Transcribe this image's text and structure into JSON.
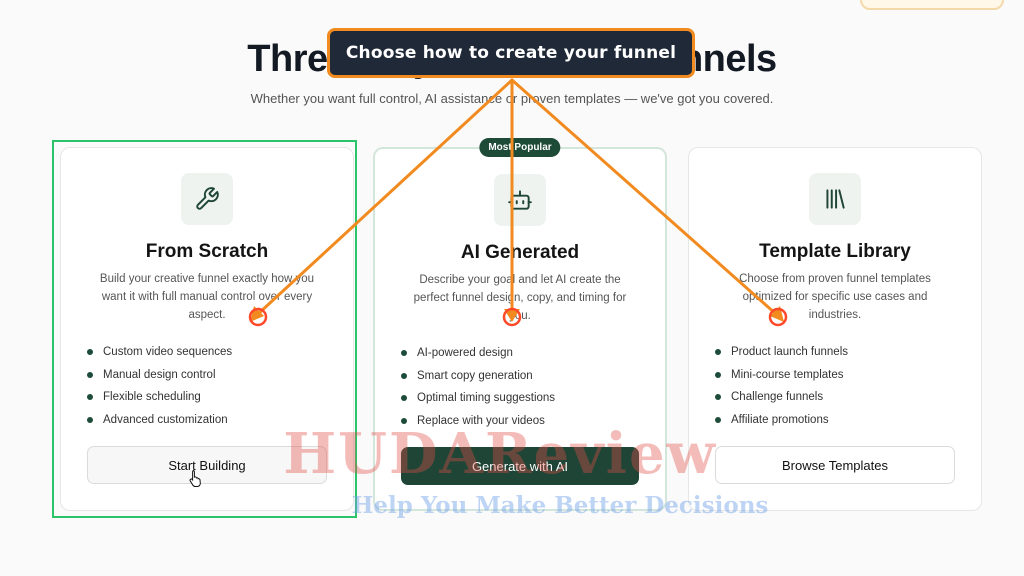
{
  "page": {
    "title": "Three Ways to Create Funnels",
    "subtitle": "Whether you want full control, AI assistance or proven templates — we've got you covered."
  },
  "callout": {
    "text": "Choose how to create your funnel"
  },
  "cards": [
    {
      "icon": "wrench-icon",
      "title": "From Scratch",
      "description": "Build your creative funnel exactly how you want it with full manual control over every aspect.",
      "features": [
        "Custom video sequences",
        "Manual design control",
        "Flexible scheduling",
        "Advanced customization"
      ],
      "button_label": "Start Building"
    },
    {
      "badge": "Most Popular",
      "icon": "robot-icon",
      "title": "AI Generated",
      "description": "Describe your goal and let AI create the perfect funnel design, copy, and timing for you.",
      "features": [
        "AI-powered design",
        "Smart copy generation",
        "Optimal timing suggestions",
        "Replace with your videos"
      ],
      "button_label": "Generate with AI"
    },
    {
      "icon": "library-icon",
      "title": "Template Library",
      "description": "Choose from proven funnel templates optimized for specific use cases and industries.",
      "features": [
        "Product launch funnels",
        "Mini-course templates",
        "Challenge funnels",
        "Affiliate promotions"
      ],
      "button_label": "Browse Templates"
    }
  ],
  "watermark": {
    "brand": "HUDAReview",
    "tagline": "Help You Make Better Decisions"
  },
  "colors": {
    "accent": "#1e4536",
    "callout_border": "#f18a1f",
    "highlight": "#2bc46a"
  }
}
